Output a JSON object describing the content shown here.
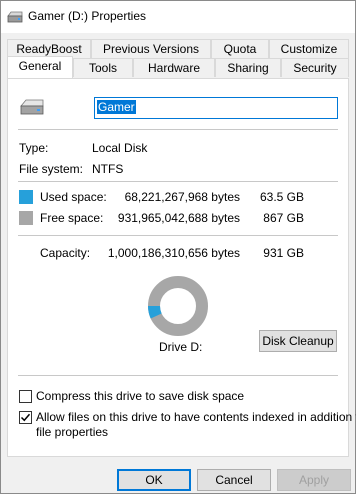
{
  "window": {
    "title": "Gamer (D:) Properties"
  },
  "tabs": {
    "row1": [
      "ReadyBoost",
      "Previous Versions",
      "Quota",
      "Customize"
    ],
    "row2": [
      "General",
      "Tools",
      "Hardware",
      "Sharing",
      "Security"
    ],
    "active": "General"
  },
  "general": {
    "drive_name": "Gamer",
    "type_label": "Type:",
    "type_value": "Local Disk",
    "fs_label": "File system:",
    "fs_value": "NTFS",
    "used": {
      "label": "Used space:",
      "bytes": "68,221,267,968 bytes",
      "size": "63.5 GB",
      "color": "#26a0da"
    },
    "free": {
      "label": "Free space:",
      "bytes": "931,965,042,688 bytes",
      "size": "867 GB",
      "color": "#a7a7a7"
    },
    "capacity": {
      "label": "Capacity:",
      "bytes": "1,000,186,310,656 bytes",
      "size": "931 GB"
    },
    "used_fraction": 0.0682,
    "drive_label": "Drive D:",
    "cleanup_label": "Disk Cleanup",
    "compress_label": "Compress this drive to save disk space",
    "compress_checked": false,
    "index_label_line1": "Allow files on this drive to have contents indexed in addition to",
    "index_label_line2": "file properties",
    "index_checked": true
  },
  "footer": {
    "ok": "OK",
    "cancel": "Cancel",
    "apply": "Apply"
  }
}
